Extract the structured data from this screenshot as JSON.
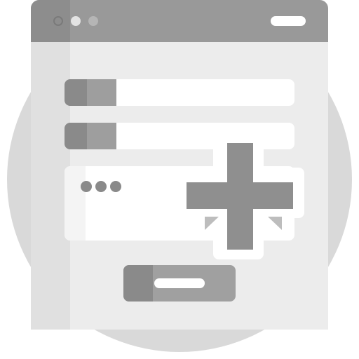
{
  "window": {
    "controls": [
      "close-dot",
      "minimize-dot",
      "maximize-dot"
    ]
  },
  "form": {
    "fields": [
      {
        "icon": "field-icon",
        "value": ""
      },
      {
        "icon": "field-icon",
        "value": ""
      }
    ],
    "message": {
      "icon": "ellipsis-icon",
      "value": ""
    }
  },
  "actions": {
    "add_icon": "plus-icon",
    "submit_icon": "submit-bar"
  },
  "colors": {
    "backdrop": "#d9d9d9",
    "window": "#ececec",
    "titlebar": "#999999",
    "field": "#ffffff",
    "icon_dark": "#8a8a8a",
    "icon_mid": "#9e9e9e"
  }
}
